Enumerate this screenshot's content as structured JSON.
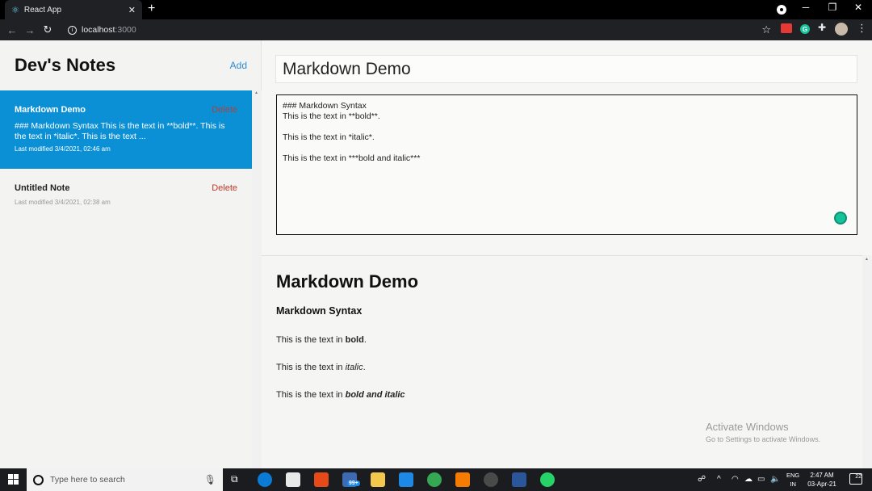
{
  "browser": {
    "tab_title": "React App",
    "tab_icon": "react-icon",
    "url_host": "localhost",
    "url_port": ":3000"
  },
  "sidebar": {
    "title": "Dev's Notes",
    "add_label": "Add",
    "notes": [
      {
        "title": "Markdown Demo",
        "delete_label": "Delete",
        "preview": "### Markdown Syntax This is the text in **bold**. This is the text in *italic*. This is the text ...",
        "modified": "Last modified 3/4/2021, 02:46 am",
        "active": true
      },
      {
        "title": "Untitled Note",
        "delete_label": "Delete",
        "modified": "Last modified 3/4/2021, 02:38 am",
        "active": false
      }
    ]
  },
  "editor": {
    "title_value": "Markdown Demo",
    "body_lines": [
      "### Markdown Syntax",
      "This is the text in **bold**.",
      "",
      "This is the text in *italic*.",
      "",
      "This is the text in ***bold and italic***"
    ]
  },
  "preview": {
    "h1": "Markdown Demo",
    "h3": "Markdown Syntax",
    "p1_prefix": "This is the text in ",
    "p1_em": "bold",
    "p1_suffix": ".",
    "p2_prefix": "This is the text in ",
    "p2_em": "italic",
    "p2_suffix": ".",
    "p3_prefix": "This is the text in ",
    "p3_em": "bold and italic"
  },
  "watermark": {
    "title": "Activate Windows",
    "subtitle": "Go to Settings to activate Windows."
  },
  "taskbar": {
    "search_placeholder": "Type here to search",
    "mail_badge": "99+",
    "lang_line1": "ENG",
    "lang_line2": "IN",
    "time": "2:47 AM",
    "date": "03-Apr-21",
    "notification_count": "22"
  },
  "colors": {
    "accent": "#0b90d6",
    "delete": "#c0392b",
    "add": "#2b8bd5"
  }
}
